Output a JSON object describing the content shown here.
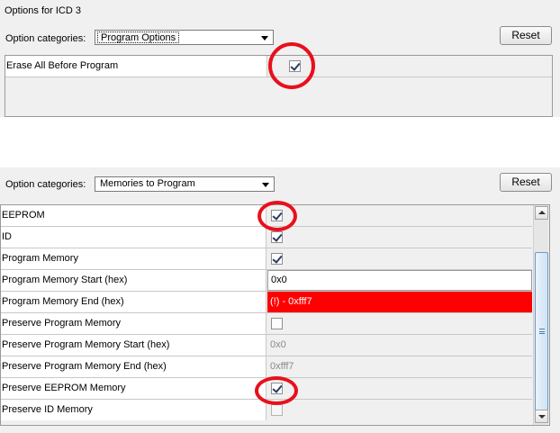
{
  "panel1": {
    "title": "Options for ICD 3",
    "category_label": "Option categories:",
    "category_value": "Program Options",
    "reset_label": "Reset",
    "rows": [
      {
        "name": "Erase All Before Program",
        "checked": true
      }
    ]
  },
  "panel2": {
    "category_label": "Option categories:",
    "category_value": "Memories to Program",
    "reset_label": "Reset",
    "rows": [
      {
        "name": "EEPROM",
        "type": "checkbox",
        "checked": true
      },
      {
        "name": "ID",
        "type": "checkbox",
        "checked": true
      },
      {
        "name": "Program Memory",
        "type": "checkbox",
        "checked": true
      },
      {
        "name": "Program Memory Start (hex)",
        "type": "text",
        "value": "0x0"
      },
      {
        "name": "Program Memory End   (hex)",
        "type": "error",
        "value": "(!) - 0xfff7"
      },
      {
        "name": "Preserve Program Memory",
        "type": "checkbox",
        "checked": false
      },
      {
        "name": "Preserve Program Memory Start (hex)",
        "type": "disabled",
        "value": "0x0"
      },
      {
        "name": "Preserve Program Memory End   (hex)",
        "type": "disabled",
        "value": "0xfff7"
      },
      {
        "name": "Preserve EEPROM Memory",
        "type": "checkbox",
        "checked": true
      },
      {
        "name": "Preserve ID Memory",
        "type": "checkbox",
        "checked": false
      }
    ]
  },
  "colors": {
    "error_bg": "#ff0000",
    "annotation_ring": "#e8101c",
    "panel_bg": "#f0f0f0"
  }
}
